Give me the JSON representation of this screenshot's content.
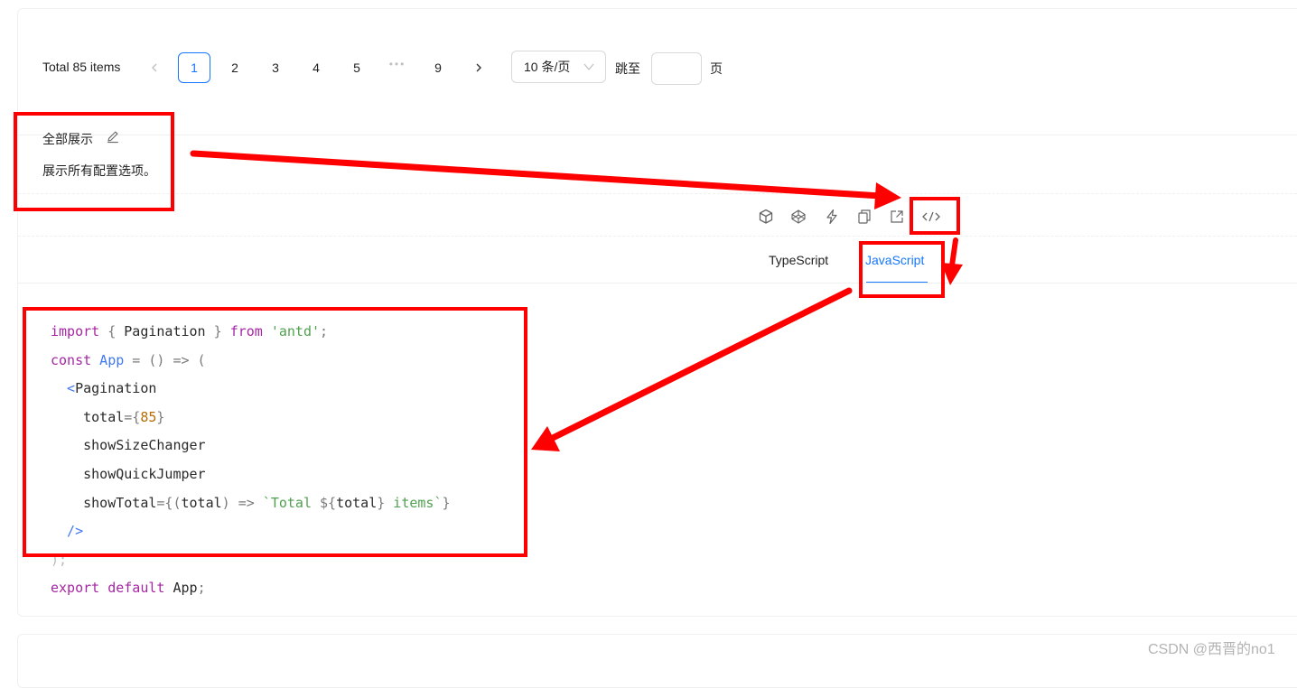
{
  "pagination": {
    "total_text": "Total 85 items",
    "pages": [
      "1",
      "2",
      "3",
      "4",
      "5",
      "9"
    ],
    "active_page": "1",
    "ellipsis": "•••",
    "page_size": "10 条/页",
    "jump_label": "跳至",
    "jump_value": "",
    "page_label": "页"
  },
  "demo": {
    "title": "全部展示",
    "description": "展示所有配置选项。"
  },
  "actions": {
    "icons": [
      "codesandbox-icon",
      "codepen-icon",
      "stackblitz-icon",
      "copy-icon",
      "external-link-icon",
      "code-expand-icon"
    ]
  },
  "tabs": {
    "items": [
      "TypeScript",
      "JavaScript"
    ],
    "active": "JavaScript",
    "active_color": "#1677ff"
  },
  "code": {
    "line1": {
      "kw1": "import",
      "p1": " { ",
      "id1": "Pagination",
      "p2": " } ",
      "kw2": "from",
      "s1": " 'antd'",
      "p3": ";"
    },
    "line2": {
      "kw1": "const",
      "id1": " App",
      "p1": " = () => ("
    },
    "line3": {
      "p1": "  <",
      "tag": "Pagination"
    },
    "line4": {
      "attr": "    total",
      "p1": "={",
      "num": "85",
      "p2": "}"
    },
    "line5": {
      "attr": "    showSizeChanger"
    },
    "line6": {
      "attr": "    showQuickJumper"
    },
    "line7": {
      "attr": "    showTotal",
      "p1": "={(",
      "id1": "total",
      "p2": ") => ",
      "s1": "`Total ",
      "p3": "${",
      "id2": "total",
      "p4": "}",
      "s2": " items`",
      "p5": "}"
    },
    "line8": {
      "p1": "  />"
    },
    "line9": {
      "p1": ");"
    },
    "line10": {
      "kw1": "export",
      "kw2": " default",
      "id1": " App",
      "p1": ";"
    }
  },
  "watermark": "CSDN @西晋的no1",
  "colors": {
    "accent": "#1677ff",
    "annotation": "#ff0000"
  }
}
